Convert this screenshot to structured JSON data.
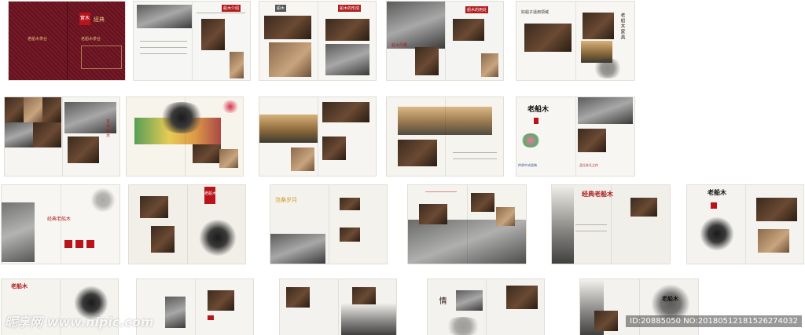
{
  "cover": {
    "seal": "實木",
    "tag": "經典",
    "title_left": "老船木茶台",
    "title_right": "老船木茶台"
  },
  "spreads": {
    "s2": {
      "heading_a": "船木介绍"
    },
    "s3": {
      "heading_a": "船木",
      "heading_b": "船木的形成"
    },
    "s4": {
      "heading_a": "船木的用处",
      "caption": "船木风格"
    },
    "s5": {
      "heading": "好船子适用领域",
      "vtext": "老船木家具"
    },
    "s7": {
      "vtext": "百年船木"
    },
    "s11": {
      "title": "老船木",
      "caption": "传承中式经典",
      "caption2": "品位非凡之作"
    },
    "s12": {
      "title": "经典老船木"
    },
    "s13": {
      "title": "老船木",
      "tag": "老船木"
    },
    "s14": {
      "title": "沧桑岁月"
    },
    "s16": {
      "title": "经典老船木"
    },
    "s17": {
      "title": "老船木"
    },
    "s18": {
      "title": "老船木",
      "sub": "历史"
    },
    "s19": {
      "title": "老船木"
    },
    "s22": {
      "title": "情"
    },
    "s23": {
      "title": "老船木"
    }
  },
  "watermark": {
    "left": "昵享网 www.nipic.com",
    "right": "ID:20885050 NO:20180512181526274032"
  },
  "colors": {
    "brand_red": "#b8141a",
    "cover_red": "#6d1220",
    "gold": "#e1c27a"
  }
}
